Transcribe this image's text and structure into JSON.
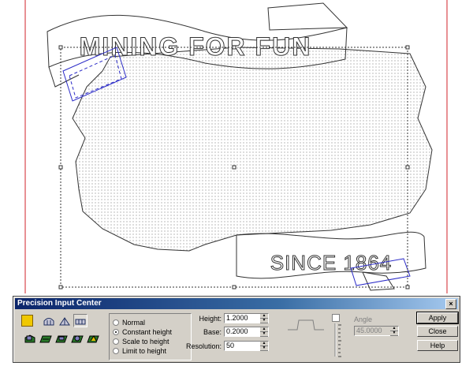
{
  "canvas": {
    "banner_top_text": "MINING FOR FUN",
    "banner_bottom_text": "SINCE 1864"
  },
  "dialog": {
    "title": "Precision Input Center",
    "close_glyph": "×",
    "tool_icons": [
      "color-swatch-icon",
      "dome-icon",
      "peak-icon",
      "flat-icon",
      "relief-1-icon",
      "relief-2-icon",
      "relief-3-icon",
      "relief-4-icon",
      "relief-5-icon"
    ],
    "modes": [
      {
        "label": "Normal",
        "selected": false
      },
      {
        "label": "Constant height",
        "selected": true
      },
      {
        "label": "Scale to height",
        "selected": false
      },
      {
        "label": "Limit to height",
        "selected": false
      }
    ],
    "fields": {
      "height_label": "Height:",
      "height_value": "1.2000",
      "base_label": "Base:",
      "base_value": "0.2000",
      "resolution_label": "Resolution:",
      "resolution_value": "50"
    },
    "angle": {
      "label": "Angle",
      "value": "45.0000",
      "enabled": false
    },
    "buttons": {
      "apply": "Apply",
      "close": "Close",
      "help": "Help"
    }
  },
  "colors": {
    "accent": "#0a246a",
    "swatch": "#f0c800",
    "selection": "#2c2cc8",
    "frame": "#d0202a"
  }
}
